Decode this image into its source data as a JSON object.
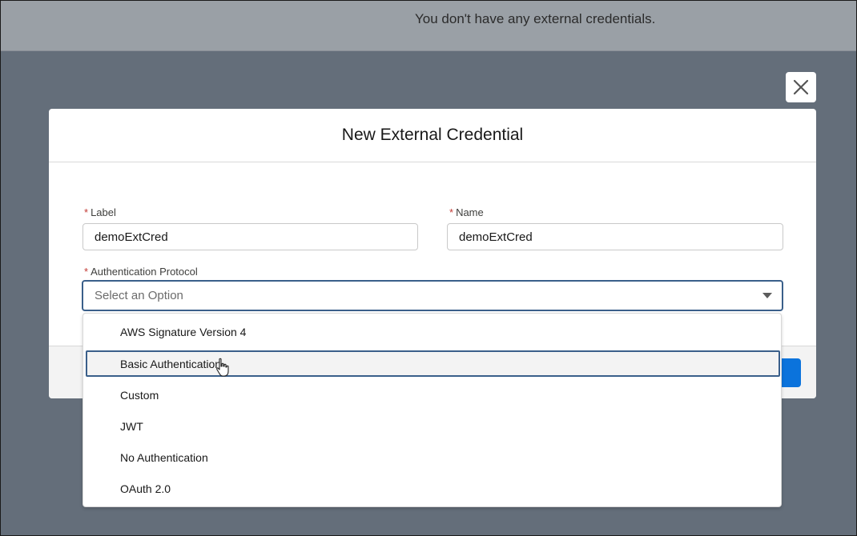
{
  "background": {
    "empty_message": "You don't have any external credentials."
  },
  "modal": {
    "title": "New External Credential",
    "close_icon": "close-icon",
    "fields": {
      "label": {
        "label": "Label",
        "required": "*",
        "value": "demoExtCred"
      },
      "name": {
        "label": "Name",
        "required": "*",
        "value": "demoExtCred"
      },
      "auth_protocol": {
        "label": "Authentication Protocol",
        "required": "*",
        "placeholder": "Select an Option",
        "options": [
          "AWS Signature Version 4",
          "Basic Authentication",
          "Custom",
          "JWT",
          "No Authentication",
          "OAuth 2.0"
        ],
        "highlighted": "Basic Authentication"
      }
    }
  },
  "colors": {
    "accent": "#0b73dc",
    "focus_border": "#3a5f8a",
    "required": "#c23934",
    "overlay": "#646e7a"
  }
}
